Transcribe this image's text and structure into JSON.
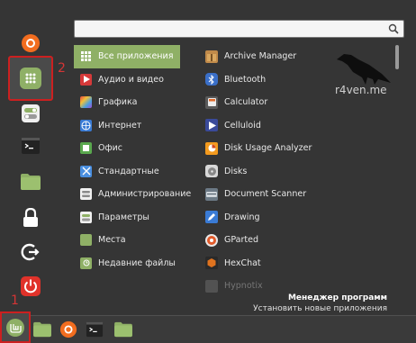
{
  "annotations": {
    "favorites_marker": "2",
    "menu_marker": "1"
  },
  "watermark": "r4ven.me",
  "search": {
    "placeholder": ""
  },
  "categories": [
    {
      "label": "Все приложения",
      "icon": "grid-icon",
      "active": true
    },
    {
      "label": "Аудио и видео",
      "icon": "play-icon"
    },
    {
      "label": "Графика",
      "icon": "graphics-icon"
    },
    {
      "label": "Интернет",
      "icon": "internet-icon"
    },
    {
      "label": "Офис",
      "icon": "office-icon"
    },
    {
      "label": "Стандартные",
      "icon": "accessories-icon"
    },
    {
      "label": "Администрирование",
      "icon": "admin-icon"
    },
    {
      "label": "Параметры",
      "icon": "settings-icon"
    },
    {
      "label": "Места",
      "icon": "folder-icon"
    },
    {
      "label": "Недавние файлы",
      "icon": "recent-folder-icon"
    }
  ],
  "apps": [
    {
      "label": "Archive Manager",
      "icon": "archive-icon"
    },
    {
      "label": "Bluetooth",
      "icon": "bluetooth-icon"
    },
    {
      "label": "Calculator",
      "icon": "calculator-icon"
    },
    {
      "label": "Celluloid",
      "icon": "celluloid-icon"
    },
    {
      "label": "Disk Usage Analyzer",
      "icon": "disk-usage-icon"
    },
    {
      "label": "Disks",
      "icon": "disks-icon"
    },
    {
      "label": "Document Scanner",
      "icon": "scanner-icon"
    },
    {
      "label": "Drawing",
      "icon": "drawing-icon"
    },
    {
      "label": "GParted",
      "icon": "gparted-icon"
    },
    {
      "label": "HexChat",
      "icon": "hexchat-icon"
    },
    {
      "label": "Hypnotix",
      "icon": "hypnotix-icon"
    }
  ],
  "description": {
    "title": "Менеджер программ",
    "subtitle": "Установить новые приложения"
  },
  "favorites": [
    "firefox-icon",
    "software-manager-icon",
    "settings-toggle-icon",
    "terminal-icon",
    "files-folder-icon",
    "lock-icon",
    "logout-icon",
    "power-icon"
  ],
  "taskbar": [
    "mint-menu-icon",
    "files-folder-icon",
    "firefox-icon",
    "terminal-icon",
    "files-folder-icon"
  ],
  "colors": {
    "accent": "#8fb066",
    "annotation": "#cc2020",
    "power": "#e0322a"
  }
}
